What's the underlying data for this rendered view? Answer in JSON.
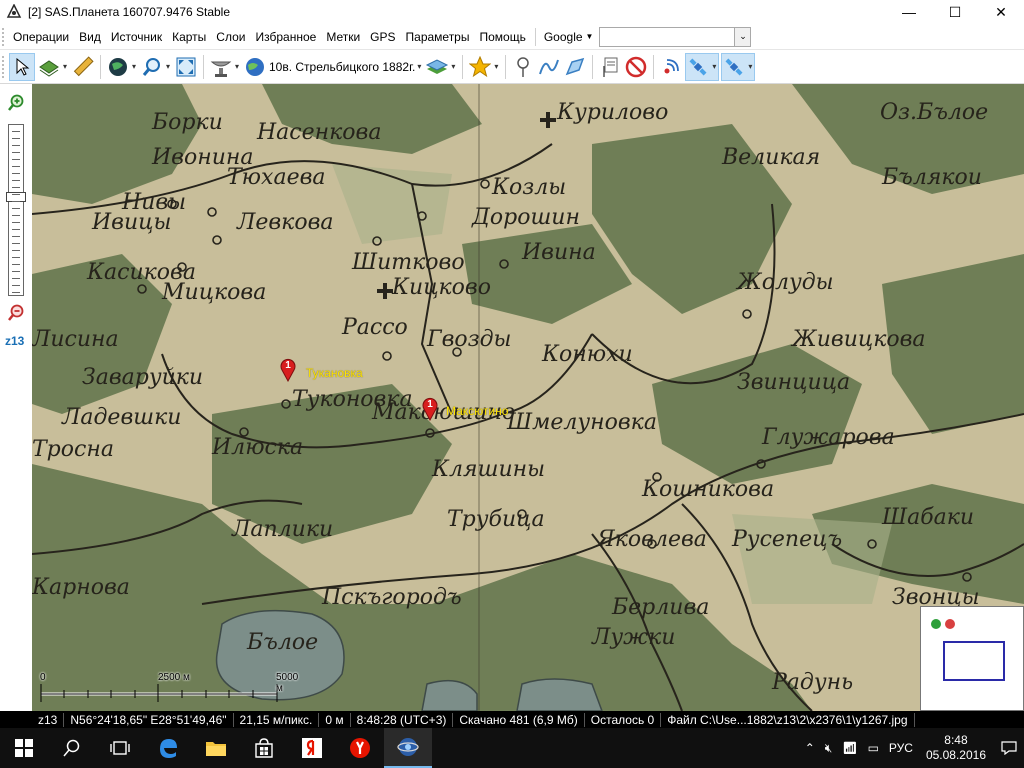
{
  "window": {
    "title": "[2] SAS.Планета 160707.9476 Stable",
    "controls": {
      "minimize": "—",
      "maximize": "☐",
      "close": "✕"
    }
  },
  "menubar": {
    "items": [
      "Операции",
      "Вид",
      "Источник",
      "Карты",
      "Слои",
      "Избранное",
      "Метки",
      "GPS",
      "Параметры",
      "Помощь"
    ],
    "search_provider": "Google",
    "search_value": ""
  },
  "toolbar": {
    "current_map": "10в. Стрельбицкого 1882г."
  },
  "zoom": {
    "level_label": "z13",
    "level_fraction": 0.42
  },
  "map": {
    "labels": [
      "Борки",
      "Насенкова",
      "Курилово",
      "Оз.Бълое",
      "Ивонина",
      "Тюхаева",
      "Великая",
      "Бълякои",
      "Ивицы",
      "Нивы",
      "Левкова",
      "Козлы",
      "Дорошин",
      "Касикова",
      "Шитково",
      "Ивина",
      "Жолуды",
      "Мицкова",
      "Кицково",
      "Рассо",
      "Гвозды",
      "Конюхи",
      "Живицкова",
      "Лисина",
      "Заваруйки",
      "Туконовка",
      "Максюшино",
      "Шмелуновка",
      "Звинцица",
      "Ладевшки",
      "Тросна",
      "Илюска",
      "Кляшины",
      "Глужарова",
      "Кошникова",
      "Лаплики",
      "Трубица",
      "Яковлева",
      "Русепецъ",
      "Карнова",
      "Пскъгородъ",
      "Бълое",
      "Берлива",
      "Лужки",
      "Радунь",
      "Шабаки",
      "Звонцы"
    ],
    "markers": [
      {
        "number": "1",
        "label": "Тукановка"
      },
      {
        "number": "1",
        "label": "Максютино"
      }
    ],
    "scale": {
      "start": "0",
      "mid": "2500 м",
      "end": "5000 м"
    }
  },
  "status": {
    "zoom": "z13",
    "coords": "N56°24'18,65\" E28°51'49,46\"",
    "resolution": "21,15 м/пикс.",
    "distance": "0 м",
    "time": "8:48:28 (UTC+3)",
    "downloaded": "Скачано 481 (6,9 Мб)",
    "remaining": "Осталось 0",
    "file": "Файл C:\\Use...1882\\z13\\2\\x2376\\1\\y1267.jpg"
  },
  "taskbar": {
    "language": "РУС",
    "time": "8:48",
    "date": "05.08.2016"
  },
  "colors": {
    "map_light": "#c9bf9c",
    "map_forest": "#6e7d55",
    "map_text": "#2a261e",
    "marker_red": "#d81e1e",
    "marker_label": "#ffe400",
    "zoom_label": "#1a6fb5",
    "taskbar_bg": "#101010"
  }
}
